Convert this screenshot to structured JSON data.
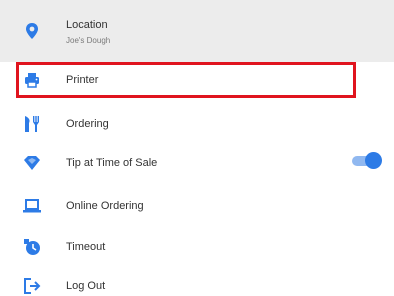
{
  "menu": {
    "location": {
      "label": "Location",
      "sub_label": "Joe's Dough",
      "icon": "location-pin-icon"
    },
    "printer": {
      "label": "Printer",
      "icon": "printer-icon",
      "highlighted": true
    },
    "ordering": {
      "label": "Ordering",
      "icon": "cutlery-icon"
    },
    "tip": {
      "label": "Tip at Time of Sale",
      "icon": "tip-diamond-icon",
      "toggle_on": true
    },
    "online_ordering": {
      "label": "Online Ordering",
      "icon": "laptop-icon"
    },
    "timeout": {
      "label": "Timeout",
      "icon": "timer-icon"
    },
    "logout": {
      "label": "Log Out",
      "icon": "logout-icon"
    }
  },
  "colors": {
    "accent": "#2d7be6",
    "highlight_border": "#e0141e",
    "location_bg": "#ececec"
  }
}
